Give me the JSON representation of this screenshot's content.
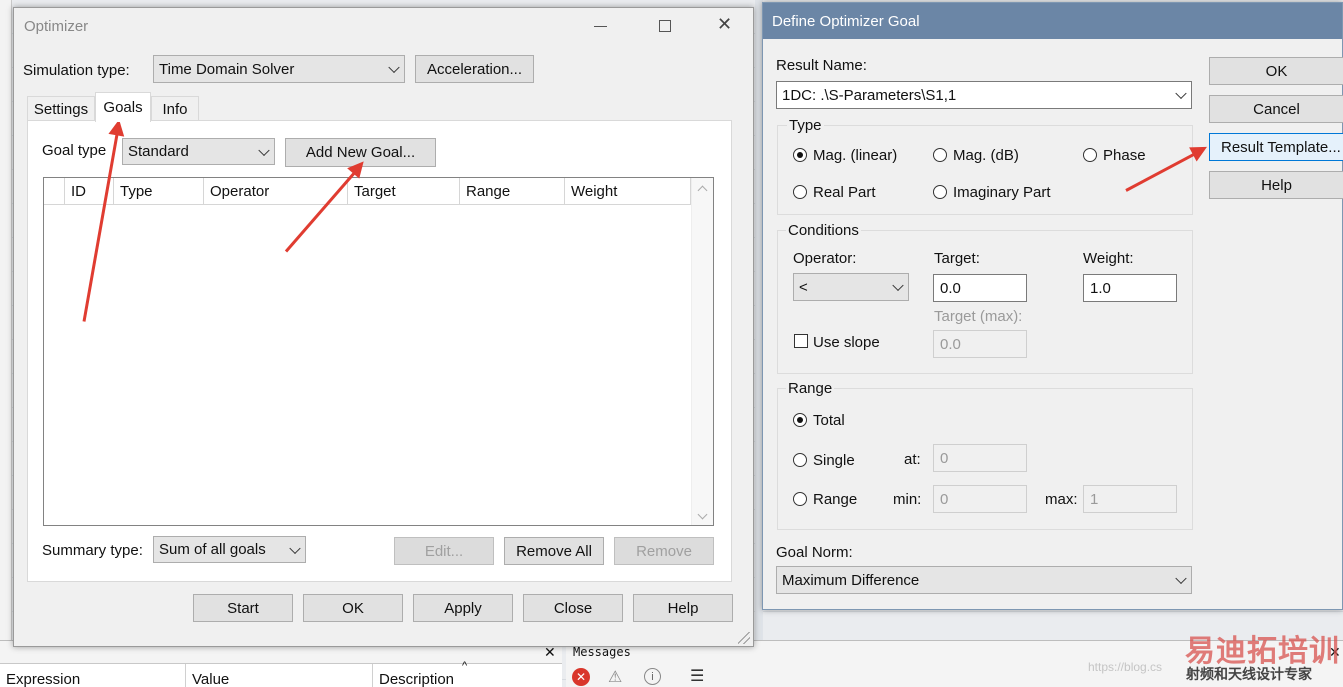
{
  "optimizer": {
    "title": "Optimizer",
    "sim_label": "Simulation type:",
    "sim_value": "Time Domain Solver",
    "acceleration_button": "Acceleration...",
    "tabs": [
      "Settings",
      "Goals",
      "Info"
    ],
    "goal_type_label": "Goal type",
    "goal_type_value": "Standard",
    "add_goal_button": "Add New Goal...",
    "columns": [
      "ID",
      "Type",
      "Operator",
      "Target",
      "Range",
      "Weight"
    ],
    "summary_label": "Summary type:",
    "summary_value": "Sum of all goals",
    "edit_button": "Edit...",
    "remove_all_button": "Remove All",
    "remove_button": "Remove",
    "footer_buttons": [
      "Start",
      "OK",
      "Apply",
      "Close",
      "Help"
    ]
  },
  "define": {
    "title": "Define Optimizer Goal",
    "result_name_label": "Result Name:",
    "result_name_value": "1DC: .\\S-Parameters\\S1,1",
    "type_group": "Type",
    "type_options": [
      "Mag. (linear)",
      "Mag. (dB)",
      "Phase",
      "Real Part",
      "Imaginary Part"
    ],
    "conditions_group": "Conditions",
    "operator_label": "Operator:",
    "operator_value": "<",
    "target_label": "Target:",
    "target_value": "0.0",
    "weight_label": "Weight:",
    "weight_value": "1.0",
    "target_max_label": "Target (max):",
    "target_max_value": "0.0",
    "use_slope_label": "Use slope",
    "range_group": "Range",
    "range_options": [
      "Total",
      "Single",
      "Range"
    ],
    "at_label": "at:",
    "at_value": "0",
    "min_label": "min:",
    "min_value": "0",
    "max_label": "max:",
    "max_value": "1",
    "goal_norm_label": "Goal Norm:",
    "goal_norm_value": "Maximum Difference",
    "side_buttons": [
      "OK",
      "Cancel",
      "Result Template...",
      "Help"
    ]
  },
  "bottom": {
    "columns": [
      "Expression",
      "Value",
      "Description"
    ],
    "messages_title": "Messages"
  },
  "watermark": {
    "brand": "易迪拓培训",
    "subtitle": "射频和天线设计专家",
    "url": "https://blog.cs"
  },
  "colors": {
    "arrow": "#e03c31",
    "focus": "#0078d7",
    "brand": "#d9534f"
  }
}
